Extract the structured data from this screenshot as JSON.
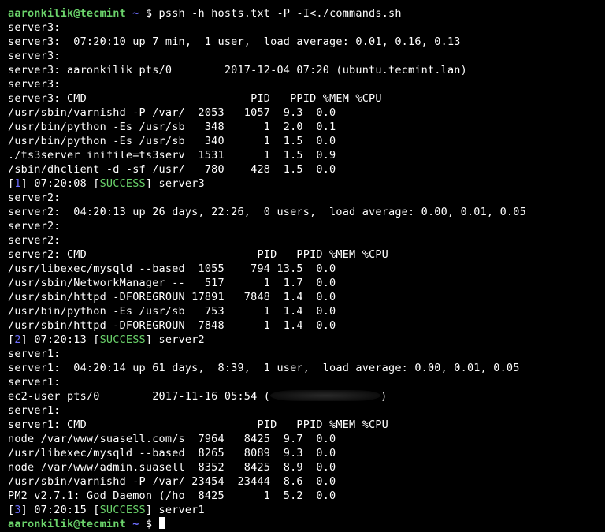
{
  "prompt": {
    "user": "aaronkilik@tecmint",
    "cwd": "~",
    "sym": "$",
    "cmd": "pssh -h hosts.txt -P -I<./commands.sh"
  },
  "server3": {
    "name": "server3",
    "uptime": " 07:20:10 up 7 min,  1 user,  load average: 0.01, 0.16, 0.13",
    "who": "aaronkilik pts/0        2017-12-04 07:20 (ubuntu.tecmint.lan)",
    "header": "CMD                         PID   PPID %MEM %CPU",
    "rows": [
      "/usr/sbin/varnishd -P /var/  2053   1057  9.3  0.0",
      "/usr/bin/python -Es /usr/sb   348      1  2.0  0.1",
      "/usr/bin/python -Es /usr/sb   340      1  1.5  0.0",
      "./ts3server inifile=ts3serv  1531      1  1.5  0.9",
      "/sbin/dhclient -d -sf /usr/   780    428  1.5  0.0"
    ],
    "status": {
      "idx": "1",
      "time": "07:20:08",
      "word": "SUCCESS"
    }
  },
  "server2": {
    "name": "server2",
    "uptime": " 04:20:13 up 26 days, 22:26,  0 users,  load average: 0.00, 0.01, 0.05",
    "header": "CMD                          PID   PPID %MEM %CPU",
    "rows": [
      "/usr/libexec/mysqld --based  1055    794 13.5  0.0",
      "/usr/sbin/NetworkManager --   517      1  1.7  0.0",
      "/usr/sbin/httpd -DFOREGROUN 17891   7848  1.4  0.0",
      "/usr/bin/python -Es /usr/sb   753      1  1.4  0.0",
      "/usr/sbin/httpd -DFOREGROUN  7848      1  1.4  0.0"
    ],
    "status": {
      "idx": "2",
      "time": "07:20:13",
      "word": "SUCCESS"
    }
  },
  "server1": {
    "name": "server1",
    "uptime": " 04:20:14 up 61 days,  8:39,  1 user,  load average: 0.00, 0.01, 0.05",
    "who": "ec2-user pts/0        2017-11-16 05:54 (",
    "who_end": ")",
    "header": "CMD                          PID   PPID %MEM %CPU",
    "rows": [
      "node /var/www/suasell.com/s  7964   8425  9.7  0.0",
      "/usr/libexec/mysqld --based  8265   8089  9.3  0.0",
      "node /var/www/admin.suasell  8352   8425  8.9  0.0",
      "/usr/sbin/varnishd -P /var/ 23454  23444  8.6  0.0",
      "PM2 v2.7.1: God Daemon (/ho  8425      1  5.2  0.0"
    ],
    "status": {
      "idx": "3",
      "time": "07:20:15",
      "word": "SUCCESS"
    }
  }
}
